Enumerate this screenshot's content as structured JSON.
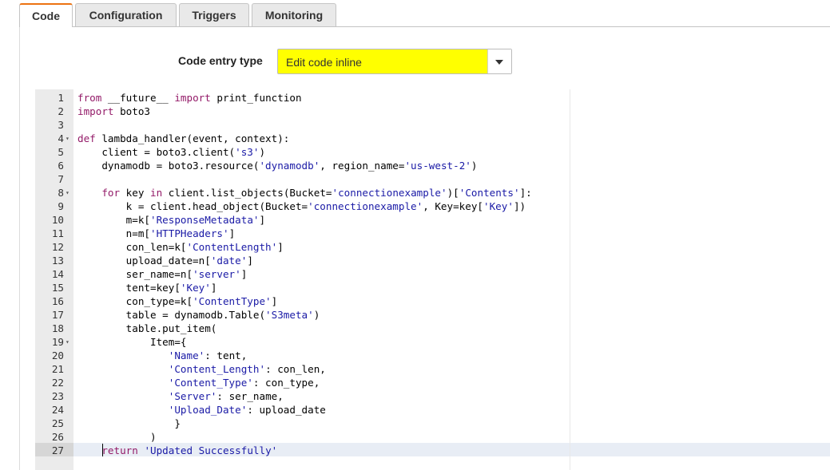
{
  "tabs": [
    {
      "label": "Code",
      "active": true
    },
    {
      "label": "Configuration",
      "active": false
    },
    {
      "label": "Triggers",
      "active": false
    },
    {
      "label": "Monitoring",
      "active": false
    }
  ],
  "code_entry": {
    "label": "Code entry type",
    "selected": "Edit code inline",
    "highlight_color": "#ffff00"
  },
  "editor": {
    "active_line": 27,
    "lines": [
      {
        "n": "1",
        "text": "from __future__ import print_function"
      },
      {
        "n": "2",
        "text": "import boto3"
      },
      {
        "n": "3",
        "text": ""
      },
      {
        "n": "4",
        "text": "def lambda_handler(event, context):"
      },
      {
        "n": "5",
        "text": "    client = boto3.client('s3')"
      },
      {
        "n": "6",
        "text": "    dynamodb = boto3.resource('dynamodb', region_name='us-west-2')"
      },
      {
        "n": "7",
        "text": ""
      },
      {
        "n": "8",
        "text": "    for key in client.list_objects(Bucket='connectionexample')['Contents']:"
      },
      {
        "n": "9",
        "text": "        k = client.head_object(Bucket='connectionexample', Key=key['Key'])"
      },
      {
        "n": "10",
        "text": "        m=k['ResponseMetadata']"
      },
      {
        "n": "11",
        "text": "        n=m['HTTPHeaders']"
      },
      {
        "n": "12",
        "text": "        con_len=k['ContentLength']"
      },
      {
        "n": "13",
        "text": "        upload_date=n['date']"
      },
      {
        "n": "14",
        "text": "        ser_name=n['server']"
      },
      {
        "n": "15",
        "text": "        tent=key['Key']"
      },
      {
        "n": "16",
        "text": "        con_type=k['ContentType']"
      },
      {
        "n": "17",
        "text": "        table = dynamodb.Table('S3meta')"
      },
      {
        "n": "18",
        "text": "        table.put_item("
      },
      {
        "n": "19",
        "text": "            Item={"
      },
      {
        "n": "20",
        "text": "               'Name': tent,"
      },
      {
        "n": "21",
        "text": "               'Content_Length': con_len,"
      },
      {
        "n": "22",
        "text": "               'Content_Type': con_type,"
      },
      {
        "n": "23",
        "text": "               'Server': ser_name,"
      },
      {
        "n": "24",
        "text": "               'Upload_Date': upload_date"
      },
      {
        "n": "25",
        "text": "                }"
      },
      {
        "n": "26",
        "text": "            )"
      },
      {
        "n": "27",
        "text": "    return 'Updated Successfully'"
      }
    ],
    "fold_lines": [
      "4",
      "8",
      "19"
    ]
  },
  "icons": {
    "dropdown": "chevron-down-icon",
    "fold": "fold-arrow-icon",
    "pointer": "mouse-pointer-icon"
  }
}
